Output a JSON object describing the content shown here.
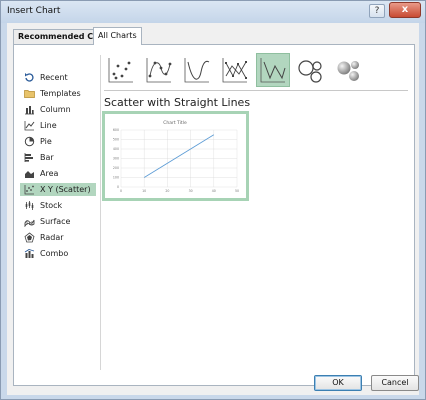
{
  "window": {
    "title": "Insert Chart",
    "help_label": "?",
    "close_label": "x"
  },
  "tabs": [
    {
      "label": "Recommended Charts",
      "selected": false
    },
    {
      "label": "All Charts",
      "selected": true
    }
  ],
  "sidebar": {
    "items": [
      {
        "label": "Recent",
        "icon": "recent-icon"
      },
      {
        "label": "Templates",
        "icon": "folder-icon"
      },
      {
        "label": "Column",
        "icon": "column-chart-icon"
      },
      {
        "label": "Line",
        "icon": "line-chart-icon"
      },
      {
        "label": "Pie",
        "icon": "pie-chart-icon"
      },
      {
        "label": "Bar",
        "icon": "bar-chart-icon"
      },
      {
        "label": "Area",
        "icon": "area-chart-icon"
      },
      {
        "label": "X Y (Scatter)",
        "icon": "scatter-chart-icon",
        "selected": true
      },
      {
        "label": "Stock",
        "icon": "stock-chart-icon"
      },
      {
        "label": "Surface",
        "icon": "surface-chart-icon"
      },
      {
        "label": "Radar",
        "icon": "radar-chart-icon"
      },
      {
        "label": "Combo",
        "icon": "combo-chart-icon"
      }
    ]
  },
  "subtypes": [
    {
      "icon": "scatter-icon"
    },
    {
      "icon": "scatter-smooth-lines-markers-icon"
    },
    {
      "icon": "scatter-smooth-lines-icon"
    },
    {
      "icon": "scatter-straight-lines-markers-icon"
    },
    {
      "icon": "scatter-straight-lines-icon",
      "selected": true
    },
    {
      "icon": "bubble-icon"
    },
    {
      "icon": "3d-bubble-icon"
    }
  ],
  "main": {
    "heading": "Scatter with Straight Lines"
  },
  "chart_data": {
    "type": "line",
    "title": "Chart Title",
    "x": [
      10,
      40
    ],
    "y": [
      100,
      550
    ],
    "xlim": [
      0,
      50
    ],
    "ylim": [
      0,
      600
    ],
    "x_ticks": [
      "0",
      "10",
      "20",
      "30",
      "40",
      "50"
    ],
    "y_ticks": [
      "0",
      "100",
      "200",
      "300",
      "400",
      "500",
      "600"
    ],
    "grid": true,
    "line_color": "#5b9bd5"
  },
  "buttons": {
    "ok_label": "OK",
    "cancel_label": "Cancel"
  },
  "colors": {
    "selected_bg": "#b2d6bf",
    "accent_blue": "#2b5b99"
  }
}
